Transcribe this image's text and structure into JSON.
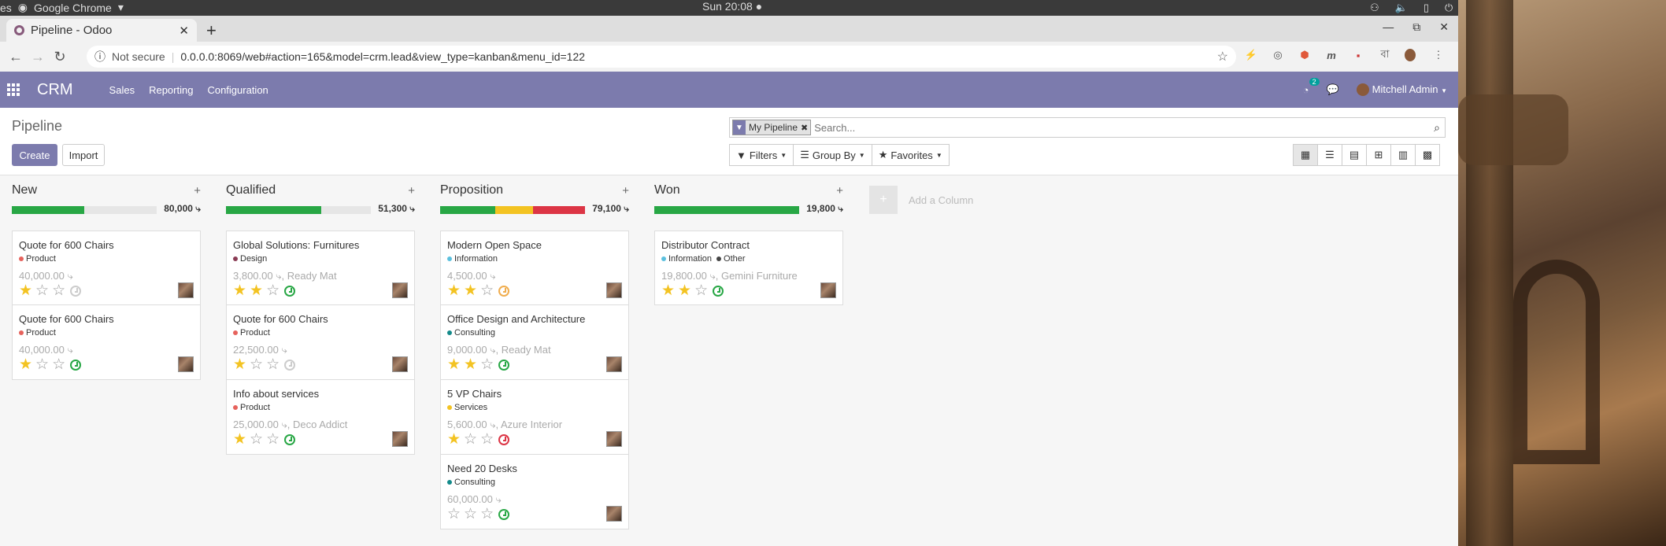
{
  "os": {
    "left_label": "es",
    "app_name": "Google Chrome",
    "clock": "Sun 20:08 ●"
  },
  "browser": {
    "tab_title": "Pipeline - Odoo",
    "not_secure": "Not secure",
    "url": "0.0.0.0:8069/web#action=165&model=crm.lead&view_type=kanban&menu_id=122"
  },
  "navbar": {
    "brand": "CRM",
    "menu": [
      "Sales",
      "Reporting",
      "Configuration"
    ],
    "activity_count": "2",
    "user": "Mitchell Admin"
  },
  "control": {
    "breadcrumb": "Pipeline",
    "create": "Create",
    "import": "Import",
    "facet": "My Pipeline",
    "search_placeholder": "Search...",
    "filters": "Filters",
    "group_by": "Group By",
    "favorites": "Favorites"
  },
  "colors": {
    "green": "#28a745",
    "orange": "#f0ad4e",
    "red": "#dc3545",
    "brand": "#7c7bad"
  },
  "columns": [
    {
      "title": "New",
      "sum": "80,000",
      "progress": [
        {
          "color": "#28a745",
          "pct": 50
        }
      ],
      "cards": [
        {
          "title": "Quote for 600 Chairs",
          "tags": [
            {
              "label": "Product",
              "color": "#e6625c"
            }
          ],
          "amount": "40,000.00",
          "customer": "",
          "stars": 1,
          "activity": "none"
        },
        {
          "title": "Quote for 600 Chairs",
          "tags": [
            {
              "label": "Product",
              "color": "#e6625c"
            }
          ],
          "amount": "40,000.00",
          "customer": "",
          "stars": 1,
          "activity": "green"
        }
      ]
    },
    {
      "title": "Qualified",
      "sum": "51,300",
      "progress": [
        {
          "color": "#28a745",
          "pct": 66
        }
      ],
      "cards": [
        {
          "title": "Global Solutions: Furnitures",
          "tags": [
            {
              "label": "Design",
              "color": "#8a3b54"
            }
          ],
          "amount": "3,800.00",
          "customer": "Ready Mat",
          "stars": 2,
          "activity": "green"
        },
        {
          "title": "Quote for 600 Chairs",
          "tags": [
            {
              "label": "Product",
              "color": "#e6625c"
            }
          ],
          "amount": "22,500.00",
          "customer": "",
          "stars": 1,
          "activity": "none"
        },
        {
          "title": "Info about services",
          "tags": [
            {
              "label": "Product",
              "color": "#e6625c"
            }
          ],
          "amount": "25,000.00",
          "customer": "Deco Addict",
          "stars": 1,
          "activity": "green"
        }
      ]
    },
    {
      "title": "Proposition",
      "sum": "79,100",
      "progress": [
        {
          "color": "#28a745",
          "pct": 38
        },
        {
          "color": "#f3c322",
          "pct": 26
        },
        {
          "color": "#dc3545",
          "pct": 36
        }
      ],
      "cards": [
        {
          "title": "Modern Open Space",
          "tags": [
            {
              "label": "Information",
              "color": "#5bc0de"
            }
          ],
          "amount": "4,500.00",
          "customer": "",
          "stars": 2,
          "activity": "orange"
        },
        {
          "title": "Office Design and Architecture",
          "tags": [
            {
              "label": "Consulting",
              "color": "#138a8a"
            }
          ],
          "amount": "9,000.00",
          "customer": "Ready Mat",
          "stars": 2,
          "activity": "green"
        },
        {
          "title": "5 VP Chairs",
          "tags": [
            {
              "label": "Services",
              "color": "#f3c322"
            }
          ],
          "amount": "5,600.00",
          "customer": "Azure Interior",
          "stars": 1,
          "activity": "red"
        },
        {
          "title": "Need 20 Desks",
          "tags": [
            {
              "label": "Consulting",
              "color": "#138a8a"
            }
          ],
          "amount": "60,000.00",
          "customer": "",
          "stars": 0,
          "activity": "green"
        }
      ]
    },
    {
      "title": "Won",
      "sum": "19,800",
      "progress": [
        {
          "color": "#28a745",
          "pct": 100
        }
      ],
      "cards": [
        {
          "title": "Distributor Contract",
          "tags": [
            {
              "label": "Information",
              "color": "#5bc0de"
            },
            {
              "label": "Other",
              "color": "#444"
            }
          ],
          "amount": "19,800.00",
          "customer": "Gemini Furniture",
          "stars": 2,
          "activity": "green"
        }
      ]
    }
  ],
  "add_column": "Add a Column"
}
